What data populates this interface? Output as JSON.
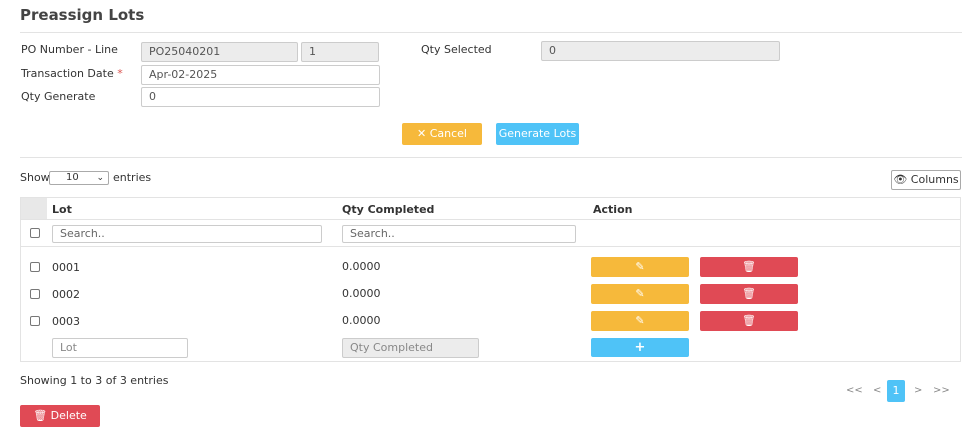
{
  "page_title": "Preassign Lots",
  "form": {
    "po_label": "PO Number - Line",
    "po_number": "PO25040201",
    "po_line": "1",
    "qty_selected_label": "Qty Selected",
    "qty_selected": "0",
    "transaction_date_label": "Transaction Date",
    "required_mark": "*",
    "transaction_date": "Apr-02-2025",
    "qty_generate_label": "Qty Generate",
    "qty_generate": "0"
  },
  "buttons": {
    "cancel_label": "Cancel",
    "generate_label": "Generate Lots",
    "columns_label": "Columns",
    "delete_label": "Delete"
  },
  "table": {
    "show_label": "Show",
    "entries_value": "10",
    "entries_label": "entries",
    "headers": {
      "lot": "Lot",
      "qty": "Qty Completed",
      "action": "Action"
    },
    "search_placeholder": "Search..",
    "rows": [
      {
        "lot": "0001",
        "qty": "0.0000"
      },
      {
        "lot": "0002",
        "qty": "0.0000"
      },
      {
        "lot": "0003",
        "qty": "0.0000"
      }
    ],
    "new_lot_placeholder": "Lot",
    "new_qty_placeholder": "Qty Completed",
    "add_label": "+"
  },
  "footer": {
    "info": "Showing 1 to 3 of 3 entries",
    "pagination": {
      "first": "<<",
      "prev": "<",
      "current": "1",
      "next": ">",
      "last": ">>"
    }
  },
  "colors": {
    "warning": "#f6b93b",
    "info": "#4fc3f7",
    "danger": "#e04a55"
  }
}
